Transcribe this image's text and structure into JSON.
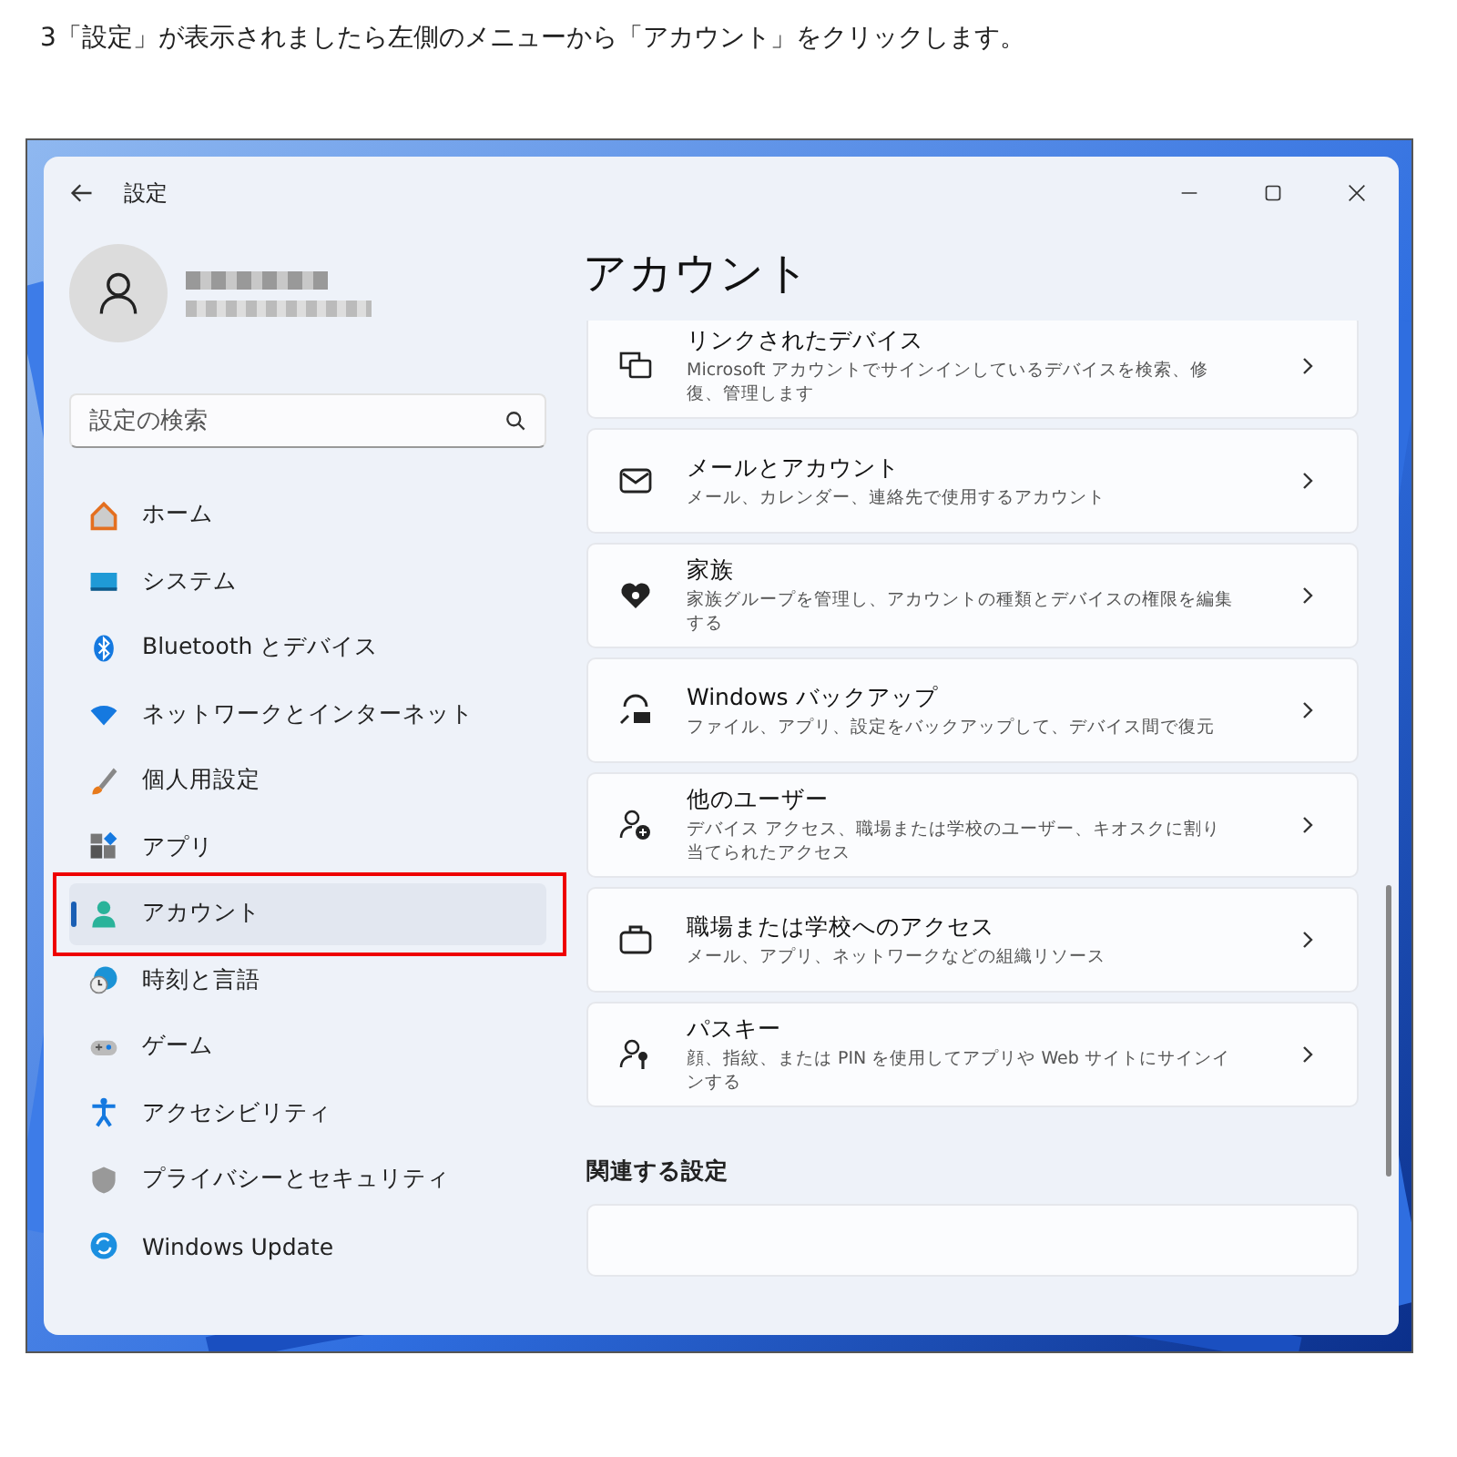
{
  "caption": "3「設定」が表示されましたら左側のメニューから「アカウント」をクリックします。",
  "window": {
    "title": "設定"
  },
  "search": {
    "placeholder": "設定の検索"
  },
  "sidebar": {
    "items": [
      {
        "label": "ホーム",
        "selected": false,
        "highlighted": false
      },
      {
        "label": "システム",
        "selected": false,
        "highlighted": false
      },
      {
        "label": "Bluetooth とデバイス",
        "selected": false,
        "highlighted": false
      },
      {
        "label": "ネットワークとインターネット",
        "selected": false,
        "highlighted": false
      },
      {
        "label": "個人用設定",
        "selected": false,
        "highlighted": false
      },
      {
        "label": "アプリ",
        "selected": false,
        "highlighted": false
      },
      {
        "label": "アカウント",
        "selected": true,
        "highlighted": true
      },
      {
        "label": "時刻と言語",
        "selected": false,
        "highlighted": false
      },
      {
        "label": "ゲーム",
        "selected": false,
        "highlighted": false
      },
      {
        "label": "アクセシビリティ",
        "selected": false,
        "highlighted": false
      },
      {
        "label": "プライバシーとセキュリティ",
        "selected": false,
        "highlighted": false
      },
      {
        "label": "Windows Update",
        "selected": false,
        "highlighted": false
      }
    ]
  },
  "page": {
    "title": "アカウント",
    "cards": [
      {
        "title": "リンクされたデバイス",
        "description": "Microsoft アカウントでサインインしているデバイスを検索、修復、管理します"
      },
      {
        "title": "メールとアカウント",
        "description": "メール、カレンダー、連絡先で使用するアカウント"
      },
      {
        "title": "家族",
        "description": "家族グループを管理し、アカウントの種類とデバイスの権限を編集する"
      },
      {
        "title": "Windows バックアップ",
        "description": "ファイル、アプリ、設定をバックアップして、デバイス間で復元"
      },
      {
        "title": "他のユーザー",
        "description": "デバイス アクセス、職場または学校のユーザー、キオスクに割り当てられたアクセス"
      },
      {
        "title": "職場または学校へのアクセス",
        "description": "メール、アプリ、ネットワークなどの組織リソース"
      },
      {
        "title": "パスキー",
        "description": "顔、指紋、または PIN を使用してアプリや Web サイトにサインインする"
      }
    ],
    "related_heading": "関連する設定"
  }
}
